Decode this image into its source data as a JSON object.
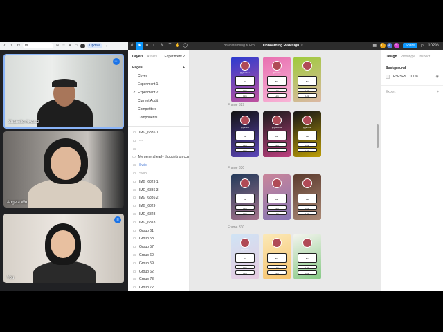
{
  "browser": {
    "omnibox": "m...",
    "update_label": "Update"
  },
  "participants": [
    {
      "name": "Shanelle Alvarez"
    },
    {
      "name": "Angela Wu"
    },
    {
      "name": "You"
    }
  ],
  "toolbar": {
    "breadcrumb": "Brainstorming & Pro...",
    "file_title": "Onboarding Redesign",
    "share_label": "Share",
    "zoom": "102%",
    "collaborators": [
      {
        "initial": "C",
        "color": "#e8a317"
      },
      {
        "initial": "A",
        "color": "#4a7bd6"
      },
      {
        "initial": "S",
        "color": "#d43fcf"
      }
    ]
  },
  "left_panel": {
    "tabs": [
      "Layers",
      "Assets"
    ],
    "page_selector": "Experiment 2",
    "pages_heading": "Pages",
    "pages": [
      {
        "label": "Cover",
        "current": false
      },
      {
        "label": "Experiment 1",
        "current": false
      },
      {
        "label": "Experiment 2",
        "current": true
      },
      {
        "label": "Current Audit",
        "current": false
      },
      {
        "label": "Competitors",
        "current": false
      },
      {
        "label": "Components",
        "current": false
      }
    ],
    "layers": [
      {
        "label": "IMG_6835 1",
        "style": "normal"
      },
      {
        "label": "---",
        "style": "muted"
      },
      {
        "label": "---",
        "style": "muted"
      },
      {
        "label": "My general early thoughts on cust...",
        "style": "normal"
      },
      {
        "label": "Swip",
        "style": "blue"
      },
      {
        "label": "Swip",
        "style": "muted"
      },
      {
        "label": "IMG_6829 1",
        "style": "normal"
      },
      {
        "label": "IMG_6836 3",
        "style": "normal"
      },
      {
        "label": "IMG_6836 2",
        "style": "normal"
      },
      {
        "label": "IMG_6829",
        "style": "normal"
      },
      {
        "label": "IMG_6828",
        "style": "normal"
      },
      {
        "label": "IMG_6818",
        "style": "normal"
      },
      {
        "label": "Group 61",
        "style": "normal"
      },
      {
        "label": "Group 58",
        "style": "normal"
      },
      {
        "label": "Group 57",
        "style": "normal"
      },
      {
        "label": "Group 60",
        "style": "normal"
      },
      {
        "label": "Group 59",
        "style": "normal"
      },
      {
        "label": "Group 62",
        "style": "normal"
      },
      {
        "label": "Group 73",
        "style": "normal"
      },
      {
        "label": "Group 72",
        "style": "normal"
      }
    ]
  },
  "canvas": {
    "frame_labels": [
      "Frame 329",
      "Frame 330",
      "Frame 330"
    ],
    "rows": [
      {
        "screens": [
          {
            "bg": "#2a3bd0",
            "accent": "#ff5a8a",
            "handle": "@glambee",
            "title": "Bio",
            "links": [
              "Link",
              "Link"
            ]
          },
          {
            "bg": "#e86fb0",
            "accent": "#ffd0e6",
            "handle": "@jamine",
            "title": "Bio",
            "links": [
              "Link",
              "Link"
            ]
          },
          {
            "bg": "#9ecb3a",
            "accent": "#f5b0d0",
            "handle": "",
            "title": "Bio",
            "links": [
              "Link",
              "Link"
            ]
          }
        ]
      },
      {
        "screens": [
          {
            "bg": "#121212",
            "accent": "#7a5cff",
            "handle": "@jamine",
            "title": "Bio",
            "links": [
              "Link",
              "Link"
            ]
          },
          {
            "bg": "#1a1a1a",
            "accent": "#ff4fa8",
            "handle": "@glambee",
            "title": "Bio",
            "links": [
              "Link",
              "Link"
            ]
          },
          {
            "bg": "#151515",
            "accent": "#ffd400",
            "handle": "@jamine",
            "title": "Bio",
            "links": [
              "Link",
              "Link"
            ]
          }
        ]
      },
      {
        "screens": [
          {
            "bg": "#233a5a",
            "accent": "#d88aa0",
            "handle": "",
            "title": "Bio",
            "links": [
              "Link",
              "Link"
            ]
          },
          {
            "bg": "#c9859a",
            "accent": "#6b6fbf",
            "handle": "",
            "title": "Bio",
            "links": [
              "Link",
              "Link"
            ]
          },
          {
            "bg": "#5c3b2e",
            "accent": "#c9a892",
            "handle": "",
            "title": "Bio",
            "links": [
              "Link",
              "Link"
            ]
          }
        ]
      },
      {
        "screens": [
          {
            "bg": "#cfe4f5",
            "accent": "#f0c0d8",
            "handle": "@jamine",
            "title": "Bio",
            "links": [
              "Link",
              "Link"
            ]
          },
          {
            "bg": "#fbe9b8",
            "accent": "#f4b24a",
            "handle": "",
            "title": "Bio",
            "links": [
              "Link",
              "Link"
            ]
          },
          {
            "bg": "#f4f4ef",
            "accent": "#5ab85a",
            "handle": "",
            "title": "Bio",
            "links": [
              "Link",
              "Link"
            ]
          }
        ]
      }
    ]
  },
  "right_panel": {
    "tabs": [
      "Design",
      "Prototype",
      "Inspect"
    ],
    "background_heading": "Background",
    "bg_hex": "E5E5E5",
    "bg_opacity": "100%",
    "export_label": "Export"
  }
}
